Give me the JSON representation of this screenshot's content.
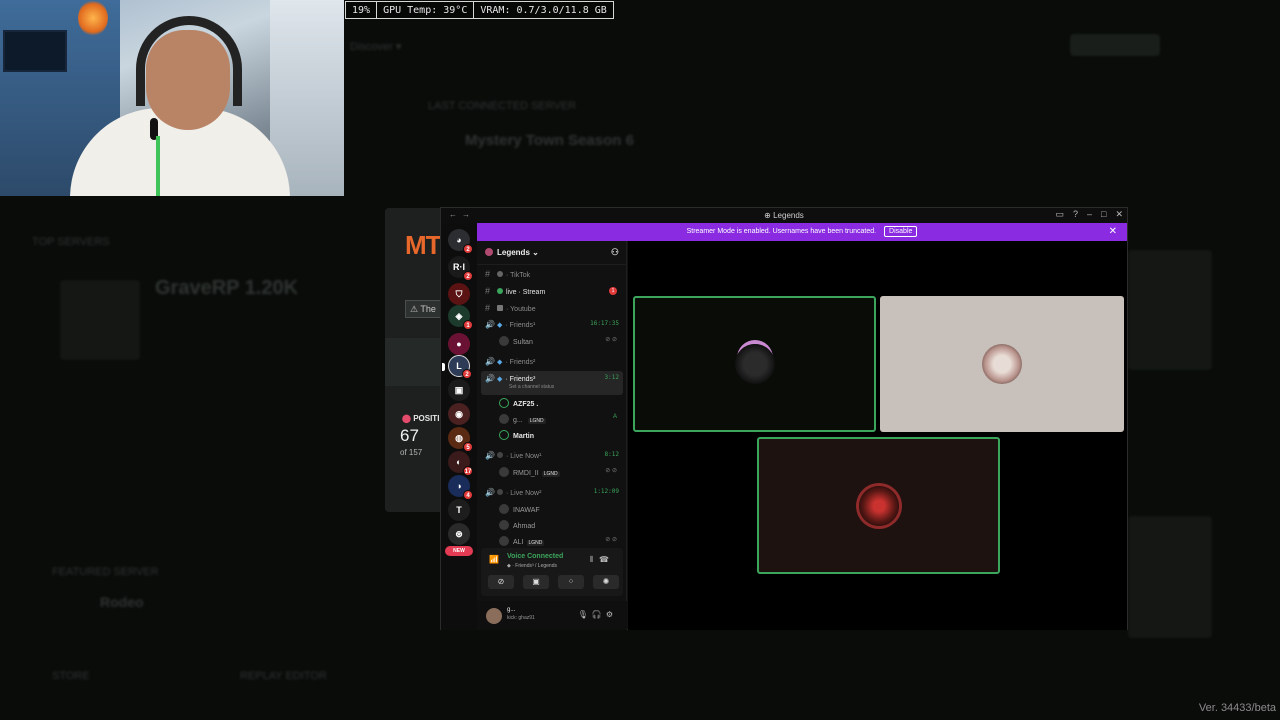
{
  "overlay": {
    "cpu": "19%",
    "gpu": "GPU Temp: 39°C",
    "vram": "VRAM: 0.7/3.0/11.8 GB"
  },
  "background": {
    "streamer_name": "GraveRP 1.20K",
    "top_servers": "TOP SERVERS",
    "last_connected": "LAST CONNECTED SERVER",
    "server_name": "Mystery Town Season 6",
    "featured": "FEATURED SERVER",
    "featured_name": "Rodeo",
    "store": "STORE",
    "replay": "REPLAY EDITOR"
  },
  "mti": {
    "logo": "MT",
    "note": "The",
    "position_label": "POSITI",
    "rank": "67",
    "of": "of 157"
  },
  "discord": {
    "window_title": "Legends",
    "banner": {
      "text": "Streamer Mode is enabled. Usernames have been truncated.",
      "disable": "Disable"
    },
    "guild_name": "Legends",
    "servers": [
      {
        "label": "",
        "badge": "2"
      },
      {
        "label": "R·I",
        "badge": "2"
      },
      {
        "label": "",
        "badge": ""
      },
      {
        "label": "",
        "badge": "1"
      },
      {
        "label": "",
        "badge": ""
      },
      {
        "label": "",
        "badge": "2"
      },
      {
        "label": "",
        "badge": ""
      },
      {
        "label": "",
        "badge": ""
      },
      {
        "label": "",
        "badge": "5"
      },
      {
        "label": "",
        "badge": "17"
      },
      {
        "label": "",
        "badge": "4"
      },
      {
        "label": "",
        "badge": ""
      },
      {
        "label": "",
        "badge": ""
      }
    ],
    "new_label": "NEW",
    "channels": [
      {
        "name": "TikTok",
        "time": ""
      },
      {
        "name": "live · Stream",
        "time": "1"
      },
      {
        "name": "Youtube",
        "time": ""
      },
      {
        "name": "Friends¹",
        "time": "16:17:35"
      },
      {
        "name": "Friends²",
        "time": ""
      },
      {
        "name": "Friends³",
        "time": "3:12",
        "status": "Set a channel status"
      },
      {
        "name": "Live Now¹",
        "time": "8:12"
      },
      {
        "name": "Live Now²",
        "time": "1:12:09"
      }
    ],
    "users": {
      "sultan": "Sultan",
      "azf": "AZF25 .",
      "g": "g... ",
      "martin": "Martin",
      "rm": "RMDI_II",
      "inawaf": "INAWAF",
      "ahmad": "Ahmad",
      "ali": "ALI",
      "tag": "LGND"
    },
    "voice": {
      "title": "Voice Connected",
      "sub": "Friends³ / Legends"
    },
    "userbar": {
      "name": "g...",
      "status": "kick: ghaz91"
    }
  },
  "version": "Ver. 34433/beta"
}
